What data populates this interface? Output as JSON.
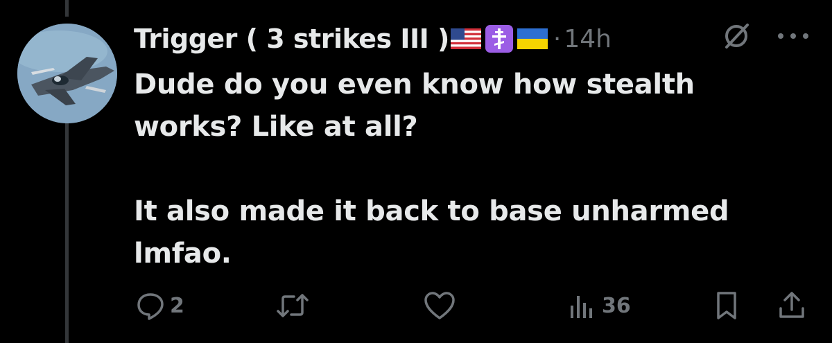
{
  "tweet": {
    "display_name": "Trigger ( 3 strikes III )",
    "separator": "·",
    "timestamp": "14h",
    "text": "Dude do you even know how stealth works? Like at all?\n\nIt also made it back to base unharmed lmfao.",
    "badges": [
      "flag-us-icon",
      "orthodox-cross-icon",
      "flag-ukraine-icon"
    ]
  },
  "actions": {
    "reply_count": "2",
    "retweet_count": "",
    "like_count": "",
    "views_count": "36"
  },
  "colors": {
    "background": "#000000",
    "text_primary": "#e7e9ea",
    "text_secondary": "#71767b",
    "thread_line": "#333639",
    "cross_badge": "#9b5de5"
  }
}
